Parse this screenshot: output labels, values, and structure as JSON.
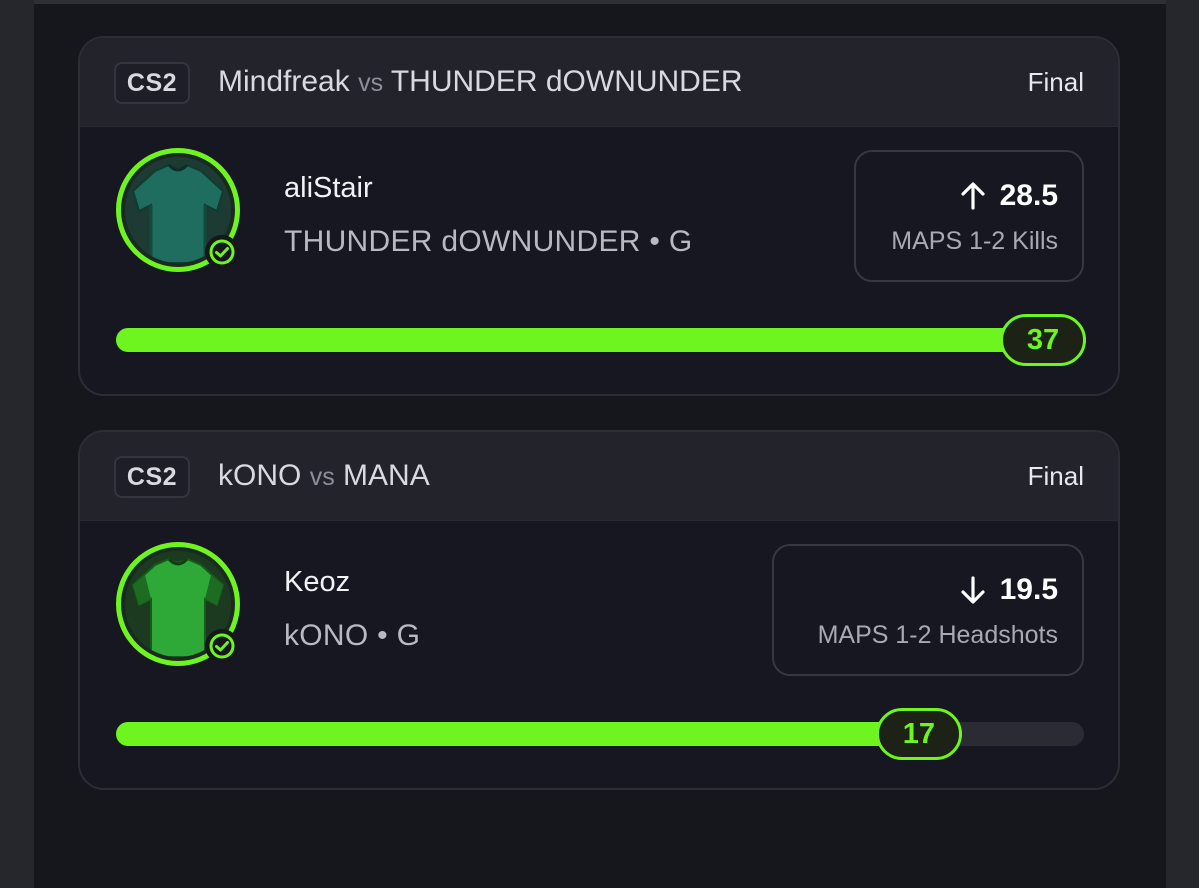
{
  "colors": {
    "accent": "#6ef41f",
    "card_bg": "#161720",
    "header_bg": "#23232c",
    "muted_text": "#a9a9b5"
  },
  "cards": [
    {
      "game": "CS2",
      "team_a": "Mindfreak",
      "vs": "vs",
      "team_b": "THUNDER dOWNUNDER",
      "status": "Final",
      "player": {
        "name": "aliStair",
        "team_line": "THUNDER dOWNUNDER • G",
        "jersey_color": "#1e6d5e",
        "jersey_icon": "jersey-icon"
      },
      "prop": {
        "direction": "up-arrow-icon",
        "line": "28.5",
        "stat": "MAPS 1-2 Kills"
      },
      "result": {
        "value": "37",
        "progress": 1.0
      }
    },
    {
      "game": "CS2",
      "team_a": "kONO",
      "vs": "vs",
      "team_b": "MANA",
      "status": "Final",
      "player": {
        "name": "Keoz",
        "team_line": "kONO • G",
        "jersey_color": "#2ea836",
        "jersey_icon": "jersey-icon"
      },
      "prop": {
        "direction": "down-arrow-icon",
        "line": "19.5",
        "stat": "MAPS 1-2 Headshots"
      },
      "result": {
        "value": "17",
        "progress": 0.872
      }
    }
  ]
}
